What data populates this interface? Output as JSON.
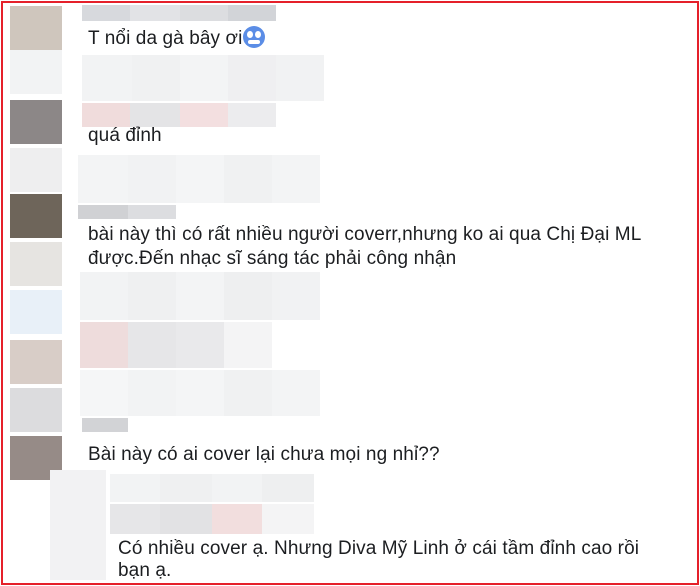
{
  "comments": [
    {
      "text": "T nổi da gà bây ơi",
      "emoji": "cold-face-emoji"
    },
    {
      "text": "quá đỉnh"
    },
    {
      "text_line1": "bài này thì có rất nhiều người coverr,nhưng ko ai qua Chị Đại ML",
      "text_line2": "được.Đến nhạc sĩ sáng tác phải công nhận"
    },
    {
      "text": "Bài này có ai cover lại chưa mọi ng nhỉ??"
    },
    {
      "text_line1": "Có nhiều cover ạ. Nhưng Diva Mỹ Linh ở cái tầm đỉnh cao rồi",
      "text_line2": "bạn ạ."
    }
  ],
  "colors": {
    "frame_border": "#e5202a",
    "text": "#1c1e21",
    "emoji": "#5b8de6"
  }
}
